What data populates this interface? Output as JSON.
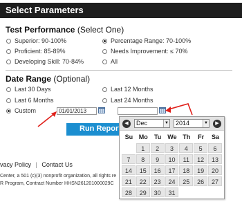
{
  "header": {
    "title": "Select Parameters"
  },
  "test_performance": {
    "title": "Test Performance",
    "title_suffix": "(Select One)",
    "options": [
      {
        "label": "Superior: 90-100%",
        "checked": false
      },
      {
        "label": "Percentage Range: 70-100%",
        "checked": true
      },
      {
        "label": "Proficient: 85-89%",
        "checked": false
      },
      {
        "label": "Needs Improvement: ≤ 70%",
        "checked": false
      },
      {
        "label": "Developing Skill: 70-84%",
        "checked": false
      },
      {
        "label": "All",
        "checked": false
      }
    ]
  },
  "date_range": {
    "title": "Date Range",
    "title_suffix": "(Optional)",
    "options": [
      {
        "label": "Last 30 Days",
        "checked": false
      },
      {
        "label": "Last 12 Months",
        "checked": false
      },
      {
        "label": "Last 6 Months",
        "checked": false
      },
      {
        "label": "Last 24 Months",
        "checked": false
      },
      {
        "label": "Custom",
        "checked": true
      }
    ],
    "start_date": "01/01/2013",
    "end_date": ""
  },
  "run_button": {
    "label": "Run Report"
  },
  "footer": {
    "privacy_link": "vacy Policy",
    "separator": "|",
    "contact_link": "Contact Us",
    "line1": "Center, a 501 (c)(3) nonprofit organization, all rights re",
    "line2": "R Program, Contract Number HHSN261201000029C"
  },
  "datepicker": {
    "prev_icon": "◀",
    "next_icon": "▶",
    "month": "Dec",
    "year": "2014",
    "caret": "▼",
    "weekdays": [
      "Su",
      "Mo",
      "Tu",
      "We",
      "Th",
      "Fr",
      "Sa"
    ],
    "weeks": [
      [
        "",
        "1",
        "2",
        "3",
        "4",
        "5",
        "6"
      ],
      [
        "7",
        "8",
        "9",
        "10",
        "11",
        "12",
        "13"
      ],
      [
        "14",
        "15",
        "16",
        "17",
        "18",
        "19",
        "20"
      ],
      [
        "21",
        "22",
        "23",
        "24",
        "25",
        "26",
        "27"
      ],
      [
        "28",
        "29",
        "30",
        "31",
        "",
        "",
        ""
      ]
    ]
  },
  "colors": {
    "header_bg": "#1e1e1e",
    "button_bg": "#1b8ed0",
    "arrow": "#e0201a"
  }
}
